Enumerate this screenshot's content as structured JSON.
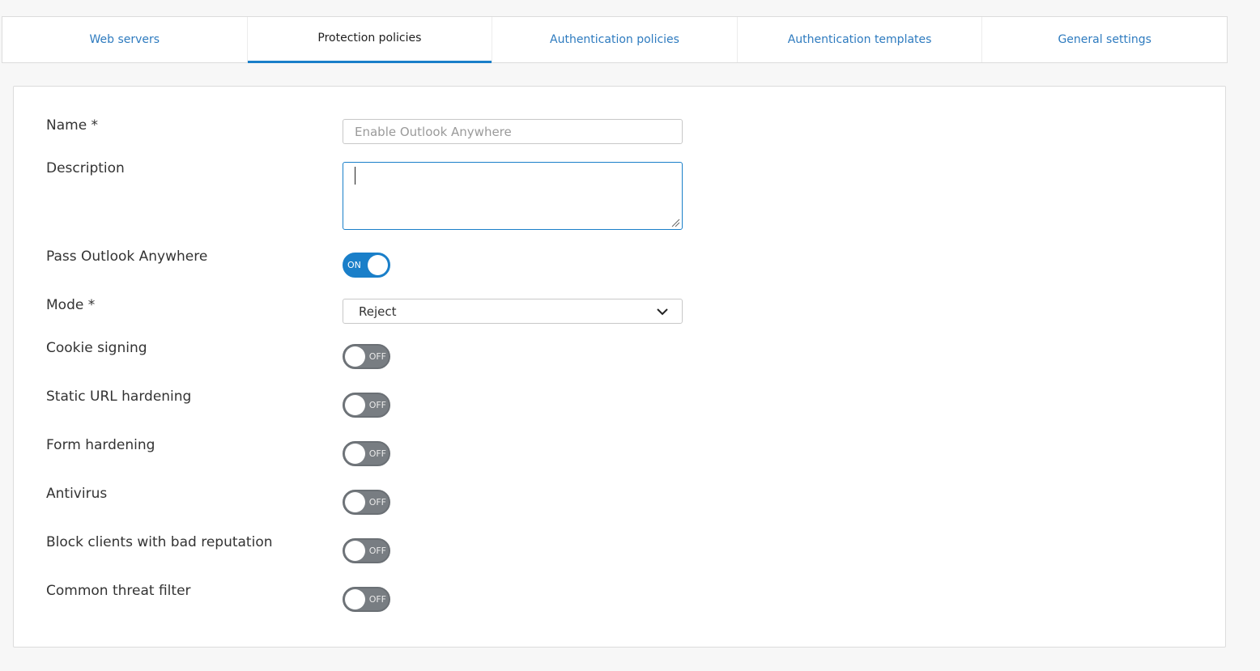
{
  "tabs": [
    {
      "label": "Web servers",
      "active": false
    },
    {
      "label": "Protection policies",
      "active": true
    },
    {
      "label": "Authentication policies",
      "active": false
    },
    {
      "label": "Authentication templates",
      "active": false
    },
    {
      "label": "General settings",
      "active": false
    }
  ],
  "form": {
    "name": {
      "label": "Name *",
      "value": "",
      "placeholder": "Enable Outlook Anywhere"
    },
    "description": {
      "label": "Description",
      "value": ""
    },
    "pass_outlook_anywhere": {
      "label": "Pass Outlook Anywhere",
      "state": "ON"
    },
    "mode": {
      "label": "Mode *",
      "value": "Reject"
    },
    "cookie_signing": {
      "label": "Cookie signing",
      "state": "OFF"
    },
    "static_url_hardening": {
      "label": "Static URL hardening",
      "state": "OFF"
    },
    "form_hardening": {
      "label": "Form hardening",
      "state": "OFF"
    },
    "antivirus": {
      "label": "Antivirus",
      "state": "OFF"
    },
    "block_bad_reputation": {
      "label": "Block clients with bad reputation",
      "state": "OFF"
    },
    "common_threat_filter": {
      "label": "Common threat filter",
      "state": "OFF"
    }
  },
  "colors": {
    "accent": "#1a7fc9",
    "link": "#2e7bbf",
    "toggle_off": "#787d82"
  },
  "icons": {
    "select_arrow": "chevron-down-icon",
    "resize": "resize-grip-icon"
  }
}
